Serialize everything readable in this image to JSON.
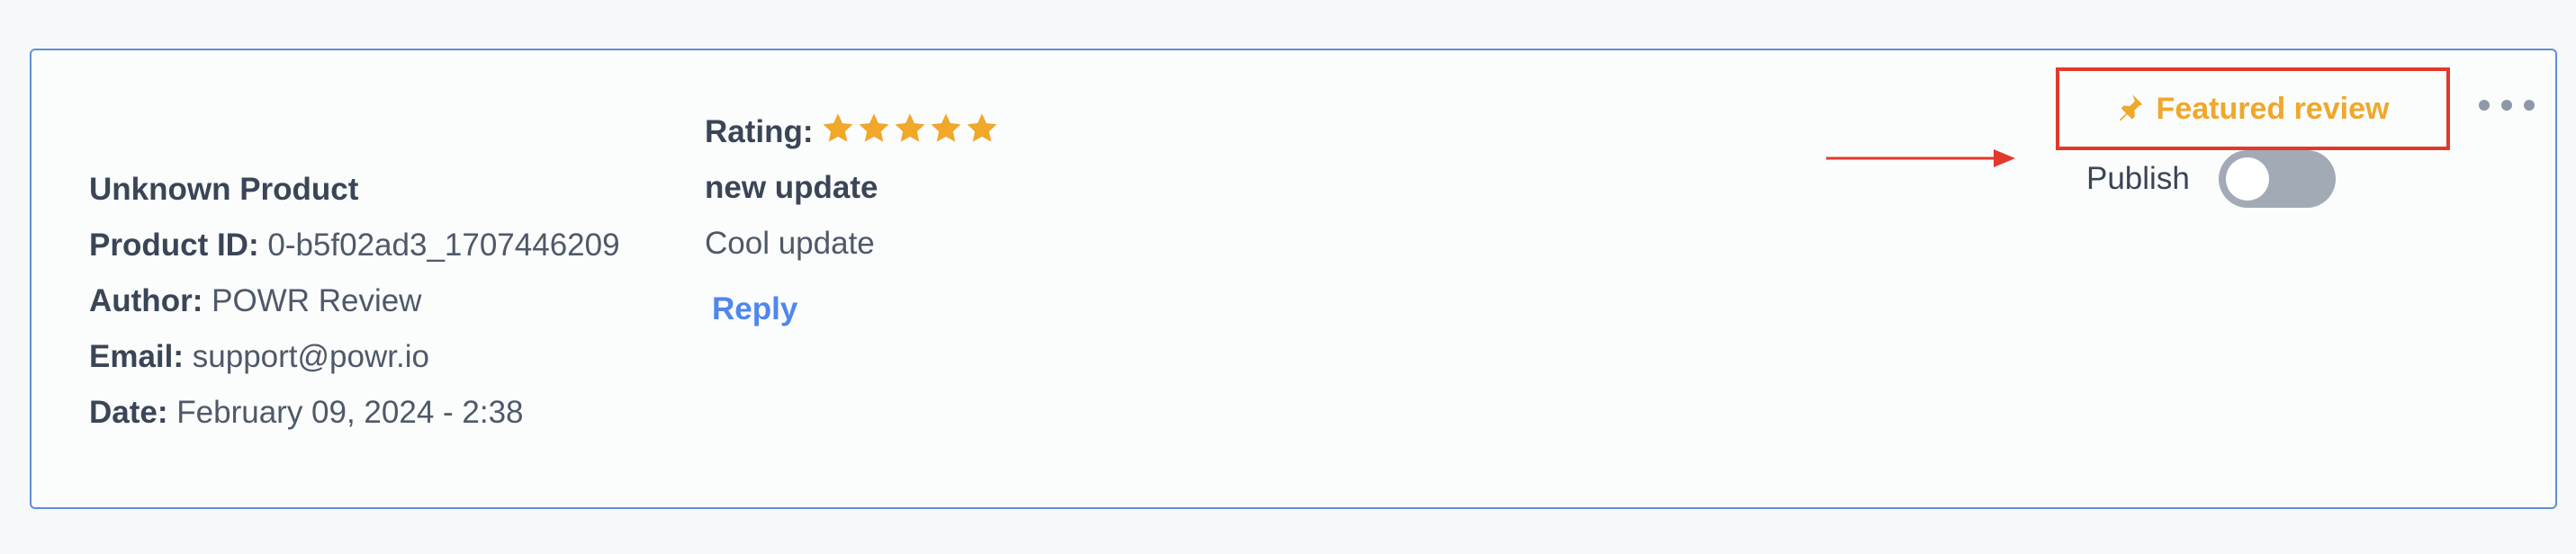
{
  "review": {
    "product_name": "Unknown Product",
    "product_id_label": "Product ID:",
    "product_id": "0-b5f02ad3_1707446209",
    "author_label": "Author:",
    "author": "POWR Review",
    "email_label": "Email:",
    "email": "support@powr.io",
    "date_label": "Date:",
    "date": "February 09, 2024 - 2:38",
    "rating_label": "Rating:",
    "rating": 5,
    "rating_max": 5,
    "title": "new update",
    "body": "Cool update",
    "reply_label": "Reply"
  },
  "actions": {
    "featured_label": "Featured review",
    "publish_label": "Publish",
    "publish_on": false,
    "more_icon": "more-horizontal-icon",
    "featured_icon": "pin-icon"
  },
  "colors": {
    "card_border": "#5f8fd9",
    "star": "#f0a72a",
    "featured_text": "#f0a72a",
    "highlight_box": "#e1392b",
    "reply_link": "#4f86f0",
    "toggle_off": "#a2aab6"
  }
}
